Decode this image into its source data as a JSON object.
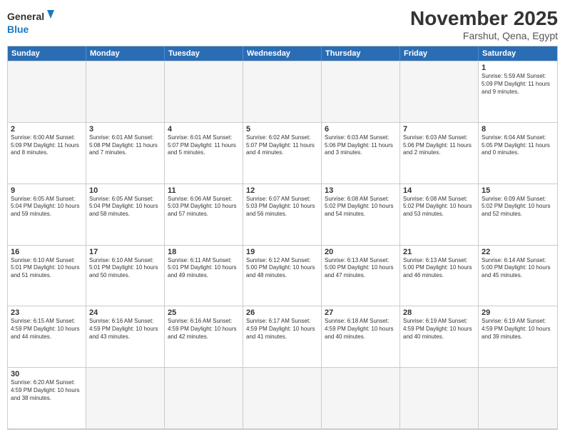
{
  "logo": {
    "text_general": "General",
    "text_blue": "Blue"
  },
  "header": {
    "month": "November 2025",
    "location": "Farshut, Qena, Egypt"
  },
  "day_headers": [
    "Sunday",
    "Monday",
    "Tuesday",
    "Wednesday",
    "Thursday",
    "Friday",
    "Saturday"
  ],
  "cells": [
    {
      "day": "",
      "content": "",
      "empty": true
    },
    {
      "day": "",
      "content": "",
      "empty": true
    },
    {
      "day": "",
      "content": "",
      "empty": true
    },
    {
      "day": "",
      "content": "",
      "empty": true
    },
    {
      "day": "",
      "content": "",
      "empty": true
    },
    {
      "day": "",
      "content": "",
      "empty": true
    },
    {
      "day": "1",
      "content": "Sunrise: 5:59 AM\nSunset: 5:09 PM\nDaylight: 11 hours\nand 9 minutes."
    },
    {
      "day": "2",
      "content": "Sunrise: 6:00 AM\nSunset: 5:09 PM\nDaylight: 11 hours\nand 8 minutes."
    },
    {
      "day": "3",
      "content": "Sunrise: 6:01 AM\nSunset: 5:08 PM\nDaylight: 11 hours\nand 7 minutes."
    },
    {
      "day": "4",
      "content": "Sunrise: 6:01 AM\nSunset: 5:07 PM\nDaylight: 11 hours\nand 5 minutes."
    },
    {
      "day": "5",
      "content": "Sunrise: 6:02 AM\nSunset: 5:07 PM\nDaylight: 11 hours\nand 4 minutes."
    },
    {
      "day": "6",
      "content": "Sunrise: 6:03 AM\nSunset: 5:06 PM\nDaylight: 11 hours\nand 3 minutes."
    },
    {
      "day": "7",
      "content": "Sunrise: 6:03 AM\nSunset: 5:06 PM\nDaylight: 11 hours\nand 2 minutes."
    },
    {
      "day": "8",
      "content": "Sunrise: 6:04 AM\nSunset: 5:05 PM\nDaylight: 11 hours\nand 0 minutes."
    },
    {
      "day": "9",
      "content": "Sunrise: 6:05 AM\nSunset: 5:04 PM\nDaylight: 10 hours\nand 59 minutes."
    },
    {
      "day": "10",
      "content": "Sunrise: 6:05 AM\nSunset: 5:04 PM\nDaylight: 10 hours\nand 58 minutes."
    },
    {
      "day": "11",
      "content": "Sunrise: 6:06 AM\nSunset: 5:03 PM\nDaylight: 10 hours\nand 57 minutes."
    },
    {
      "day": "12",
      "content": "Sunrise: 6:07 AM\nSunset: 5:03 PM\nDaylight: 10 hours\nand 56 minutes."
    },
    {
      "day": "13",
      "content": "Sunrise: 6:08 AM\nSunset: 5:02 PM\nDaylight: 10 hours\nand 54 minutes."
    },
    {
      "day": "14",
      "content": "Sunrise: 6:08 AM\nSunset: 5:02 PM\nDaylight: 10 hours\nand 53 minutes."
    },
    {
      "day": "15",
      "content": "Sunrise: 6:09 AM\nSunset: 5:02 PM\nDaylight: 10 hours\nand 52 minutes."
    },
    {
      "day": "16",
      "content": "Sunrise: 6:10 AM\nSunset: 5:01 PM\nDaylight: 10 hours\nand 51 minutes."
    },
    {
      "day": "17",
      "content": "Sunrise: 6:10 AM\nSunset: 5:01 PM\nDaylight: 10 hours\nand 50 minutes."
    },
    {
      "day": "18",
      "content": "Sunrise: 6:11 AM\nSunset: 5:01 PM\nDaylight: 10 hours\nand 49 minutes."
    },
    {
      "day": "19",
      "content": "Sunrise: 6:12 AM\nSunset: 5:00 PM\nDaylight: 10 hours\nand 48 minutes."
    },
    {
      "day": "20",
      "content": "Sunrise: 6:13 AM\nSunset: 5:00 PM\nDaylight: 10 hours\nand 47 minutes."
    },
    {
      "day": "21",
      "content": "Sunrise: 6:13 AM\nSunset: 5:00 PM\nDaylight: 10 hours\nand 46 minutes."
    },
    {
      "day": "22",
      "content": "Sunrise: 6:14 AM\nSunset: 5:00 PM\nDaylight: 10 hours\nand 45 minutes."
    },
    {
      "day": "23",
      "content": "Sunrise: 6:15 AM\nSunset: 4:59 PM\nDaylight: 10 hours\nand 44 minutes."
    },
    {
      "day": "24",
      "content": "Sunrise: 6:16 AM\nSunset: 4:59 PM\nDaylight: 10 hours\nand 43 minutes."
    },
    {
      "day": "25",
      "content": "Sunrise: 6:16 AM\nSunset: 4:59 PM\nDaylight: 10 hours\nand 42 minutes."
    },
    {
      "day": "26",
      "content": "Sunrise: 6:17 AM\nSunset: 4:59 PM\nDaylight: 10 hours\nand 41 minutes."
    },
    {
      "day": "27",
      "content": "Sunrise: 6:18 AM\nSunset: 4:59 PM\nDaylight: 10 hours\nand 40 minutes."
    },
    {
      "day": "28",
      "content": "Sunrise: 6:19 AM\nSunset: 4:59 PM\nDaylight: 10 hours\nand 40 minutes."
    },
    {
      "day": "29",
      "content": "Sunrise: 6:19 AM\nSunset: 4:59 PM\nDaylight: 10 hours\nand 39 minutes."
    },
    {
      "day": "30",
      "content": "Sunrise: 6:20 AM\nSunset: 4:59 PM\nDaylight: 10 hours\nand 38 minutes."
    },
    {
      "day": "",
      "content": "",
      "empty": true
    },
    {
      "day": "",
      "content": "",
      "empty": true
    },
    {
      "day": "",
      "content": "",
      "empty": true
    },
    {
      "day": "",
      "content": "",
      "empty": true
    },
    {
      "day": "",
      "content": "",
      "empty": true
    },
    {
      "day": "",
      "content": "",
      "empty": true
    }
  ]
}
